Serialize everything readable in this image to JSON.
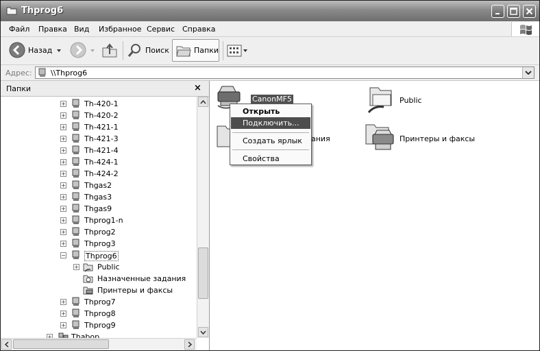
{
  "window": {
    "title": "Thprog6",
    "buttons": [
      "minimize-icon",
      "maximize-icon",
      "close-icon"
    ]
  },
  "menu": [
    "Файл",
    "Правка",
    "Вид",
    "Избранное",
    "Сервис",
    "Справка"
  ],
  "toolbar": {
    "back": "Назад",
    "search": "Поиск",
    "folders": "Папки"
  },
  "address": {
    "label": "Адрес:",
    "value": "\\\\Thprog6"
  },
  "folders_pane": {
    "title": "Папки",
    "close": "×",
    "tree": [
      {
        "label": "Th-420-1",
        "expander": "+"
      },
      {
        "label": "Th-420-2",
        "expander": "+"
      },
      {
        "label": "Th-421-1",
        "expander": "+"
      },
      {
        "label": "Th-421-3",
        "expander": "+"
      },
      {
        "label": "Th-421-4",
        "expander": "+"
      },
      {
        "label": "Th-424-1",
        "expander": "+"
      },
      {
        "label": "Th-424-2",
        "expander": "+"
      },
      {
        "label": "Thgas2",
        "expander": "+"
      },
      {
        "label": "Thgas3",
        "expander": "+"
      },
      {
        "label": "Thgas9",
        "expander": "+"
      },
      {
        "label": "Thprog1-n",
        "expander": "+"
      },
      {
        "label": "Thprog2",
        "expander": "+"
      },
      {
        "label": "Thprog3",
        "expander": "+"
      },
      {
        "label": "Thprog6",
        "expander": "−"
      },
      {
        "label": "Public",
        "expander": "+"
      },
      {
        "label": "Назначенные задания",
        "expander": ""
      },
      {
        "label": "Принтеры и факсы",
        "expander": ""
      },
      {
        "label": "Thprog7",
        "expander": "+"
      },
      {
        "label": "Thprog8",
        "expander": "+"
      },
      {
        "label": "Thprog9",
        "expander": "+"
      },
      {
        "label": "Thabop",
        "expander": "+"
      }
    ]
  },
  "content": {
    "items": [
      {
        "label": "CanonMF5",
        "icon": "printer-icon"
      },
      {
        "label": "Public",
        "icon": "shared-folder-icon"
      },
      {
        "label": "ания",
        "icon": "scheduled-tasks-icon"
      },
      {
        "label": "Принтеры и факсы",
        "icon": "printers-faxes-icon"
      }
    ]
  },
  "context_menu": {
    "items": [
      "Открыть",
      "Подключить...",
      "Создать ярлык",
      "Свойства"
    ]
  }
}
